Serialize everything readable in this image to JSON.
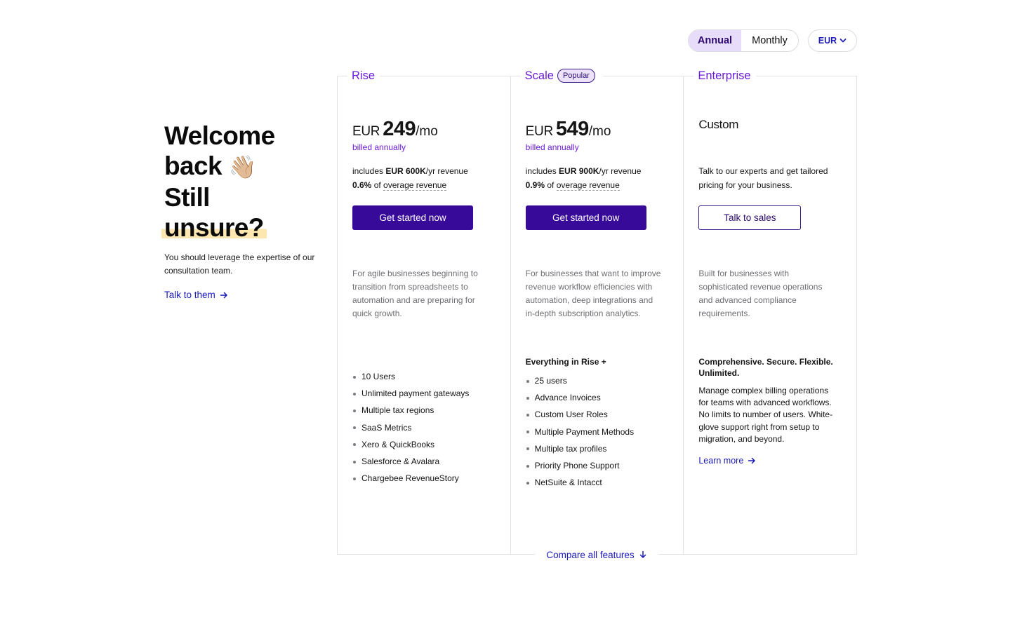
{
  "controls": {
    "billing_options": [
      "Annual",
      "Monthly"
    ],
    "billing_selected": "Annual",
    "currency": "EUR"
  },
  "hero": {
    "line1": "Welcome",
    "line2": "back",
    "wave_emoji": "👋🏼",
    "line3_prefix": "Still",
    "line3_highlight": "unsure?",
    "subtitle": "You should leverage the expertise of our consultation team.",
    "link_label": "Talk to them"
  },
  "plans": [
    {
      "name": "Rise",
      "currency": "EUR",
      "amount": "249",
      "period": "/mo",
      "billed": "billed annually",
      "includes_prefix": "includes ",
      "includes_bold": "EUR 600K",
      "includes_suffix": "/yr revenue",
      "overage_bold": "0.6%",
      "overage_mid": " of ",
      "overage_link": "overage revenue",
      "cta": "Get started now",
      "description": "For agile businesses beginning to transition from spreadsheets to automation and are preparing for quick growth.",
      "features": [
        "10 Users",
        "Unlimited payment gateways",
        "Multiple tax regions",
        "SaaS Metrics",
        "Xero & QuickBooks",
        "Salesforce & Avalara",
        "Chargebee RevenueStory"
      ]
    },
    {
      "name": "Scale",
      "badge": "Popular",
      "currency": "EUR",
      "amount": "549",
      "period": "/mo",
      "billed": "billed annually",
      "includes_prefix": "includes ",
      "includes_bold": "EUR 900K",
      "includes_suffix": "/yr revenue",
      "overage_bold": "0.9%",
      "overage_mid": " of ",
      "overage_link": "overage revenue",
      "cta": "Get started now",
      "description": "For businesses that want to improve revenue workflow efficiencies with automation, deep integrations and in-depth subscription analytics.",
      "features_heading": "Everything in Rise +",
      "features": [
        "25 users",
        "Advance Invoices",
        "Custom User Roles",
        "Multiple Payment Methods",
        "Multiple tax profiles",
        "Priority Phone Support",
        "NetSuite & Intacct"
      ]
    },
    {
      "name": "Enterprise",
      "price_label": "Custom",
      "includes_text": "Talk to our experts and get tailored pricing for your business.",
      "cta": "Talk to sales",
      "description": "Built for businesses with sophisticated revenue operations and advanced compliance requirements.",
      "features_heading": "Comprehensive. Secure. Flexible. Unlimited.",
      "body": "Manage complex billing operations for teams with advanced workflows. No limits to number of users. White-glove support right from setup to migration, and beyond.",
      "link_label": "Learn more"
    }
  ],
  "compare_label": "Compare all features",
  "colors": {
    "accent_purple": "#6a1bd8",
    "button_primary": "#380a9a",
    "link_blue": "#1a1ab8",
    "highlight": "#fde7b0",
    "toggle_active": "#e8dcfb"
  }
}
